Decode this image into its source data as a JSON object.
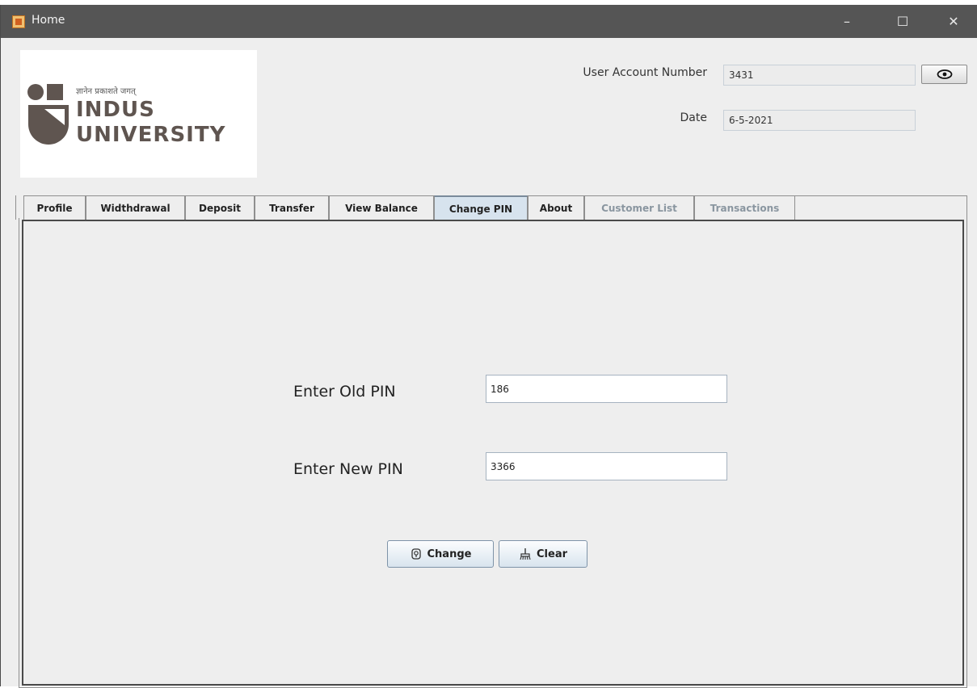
{
  "window": {
    "title": "Home",
    "min_glyph": "–",
    "max_glyph": "☐",
    "close_glyph": "✕"
  },
  "logo": {
    "tagline": "ज्ञानेन प्रकाशते जगत्",
    "line1": "INDUS",
    "line2": "UNIVERSITY"
  },
  "header": {
    "account_label": "User Account Number",
    "account_value": "3431",
    "date_label": "Date",
    "date_value": "6-5-2021",
    "reveal_icon": "eye-icon"
  },
  "tabs": [
    {
      "label": "Profile",
      "state": "normal"
    },
    {
      "label": "Widthdrawal",
      "state": "normal"
    },
    {
      "label": "Deposit",
      "state": "normal"
    },
    {
      "label": "Transfer",
      "state": "normal"
    },
    {
      "label": "View Balance",
      "state": "normal"
    },
    {
      "label": "Change PIN",
      "state": "selected"
    },
    {
      "label": "About",
      "state": "normal"
    },
    {
      "label": "Customer List",
      "state": "disabled"
    },
    {
      "label": "Transactions",
      "state": "disabled"
    }
  ],
  "form": {
    "old_pin_label": "Enter Old PIN",
    "old_pin_value": "186",
    "new_pin_label": "Enter New PIN",
    "new_pin_value": "3366",
    "change_label": "Change",
    "change_icon": "key-icon",
    "clear_label": "Clear",
    "clear_icon": "broom-icon"
  },
  "colors": {
    "titlebar": "#555555",
    "window_bg": "#eeeeee",
    "selected_tab": "#d7e3ee",
    "disabled_tab_text": "#8a96a0",
    "logo_text": "#5f5550"
  }
}
